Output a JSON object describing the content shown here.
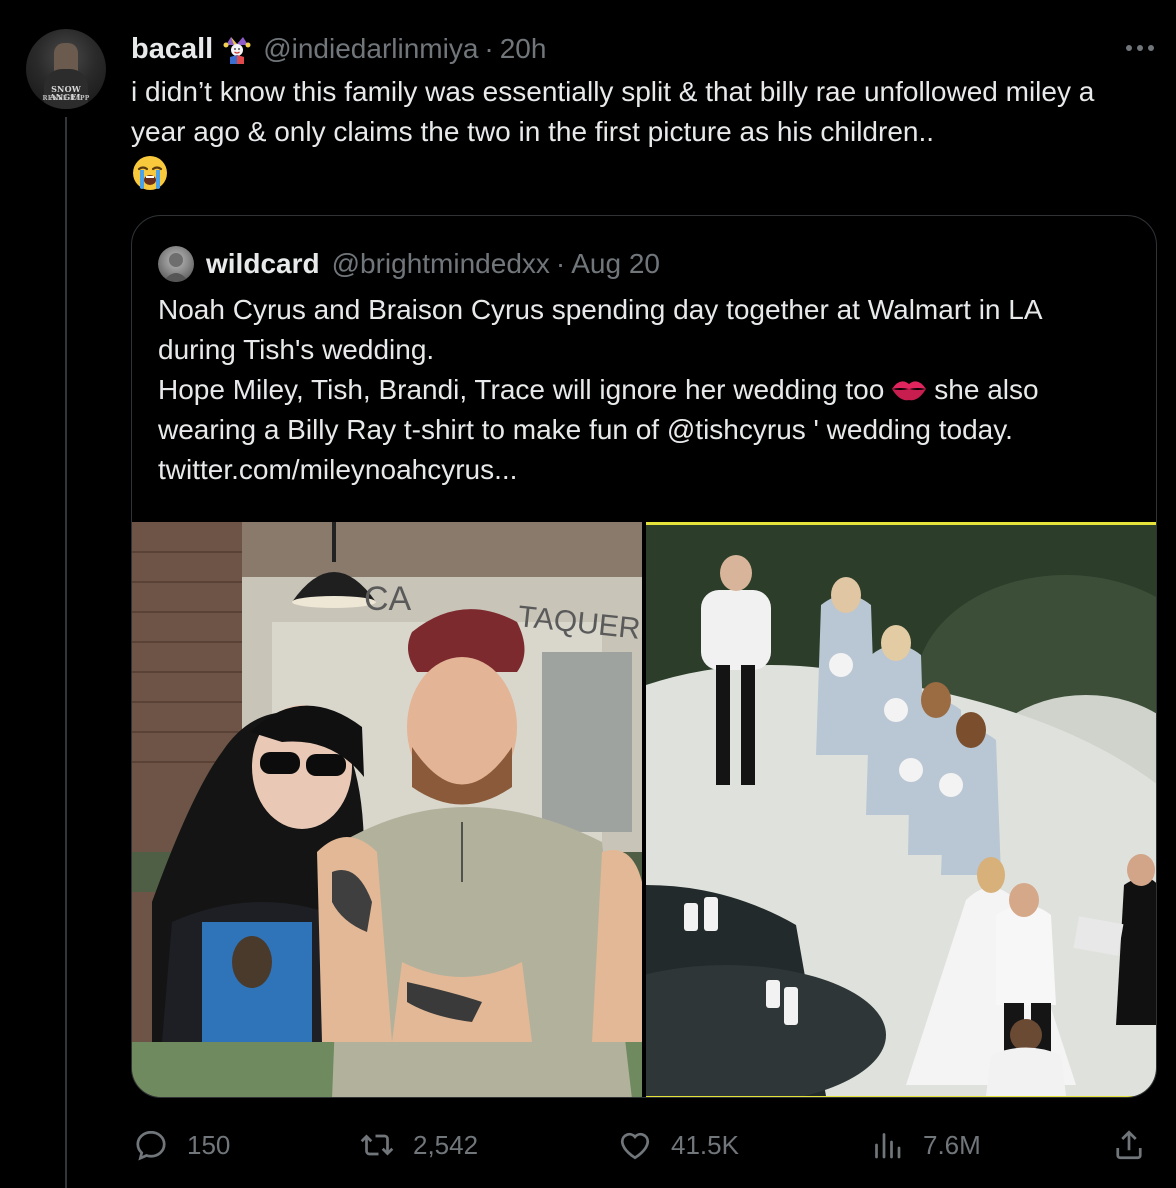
{
  "tweet": {
    "author": {
      "display_name": "bacall",
      "badge_icon": "jester-emoji-icon",
      "handle": "@indiedarlinmiya",
      "separator": "·",
      "time": "20h",
      "avatar_caption_line1": "SNOW ANGEL",
      "avatar_caption_line2": "RENEE RAPP"
    },
    "text": "i didn’t know this family was essentially split & that billy rae unfollowed miley a year ago & only claims the two in the first picture as his children..",
    "trailing_emoji": "loudly-crying-face-icon",
    "more_icon": "more-horizontal-icon"
  },
  "quote": {
    "display_name": "wildcard",
    "handle": "@brightmindedxx",
    "separator": "·",
    "date": "Aug 20",
    "lines": [
      "Noah Cyrus and Braison Cyrus spending day together at Walmart in LA",
      "during Tish's wedding.",
      "Hope Miley, Tish, Brandi, Trace will ignore her wedding too",
      "she also",
      "wearing a Billy Ray t-shirt to make fun of @tishcyrus ' wedding today.",
      "twitter.com/mileynoahcyrus..."
    ],
    "photo_left_sign": "CA",
    "photo_left_sign2": "TAQUERIA"
  },
  "actions": {
    "replies": "150",
    "reposts": "2,542",
    "likes": "41.5K",
    "views": "7.6M"
  },
  "colors": {
    "background": "#000000",
    "primary_text": "#e7e9ea",
    "secondary_text": "#71767b",
    "border": "#2f3336",
    "highlight_border": "#e4e23b"
  }
}
